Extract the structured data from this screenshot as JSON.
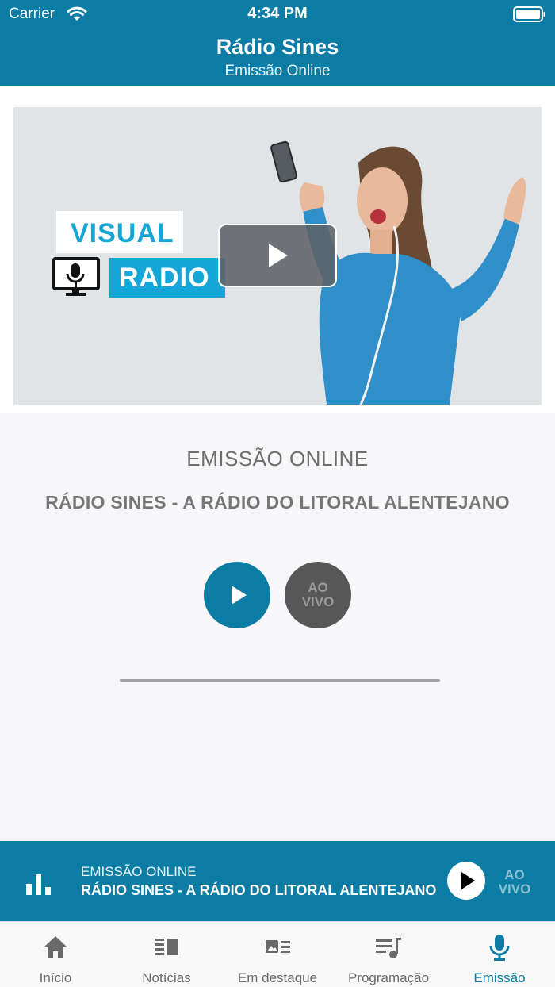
{
  "status_bar": {
    "carrier": "Carrier",
    "time": "4:34 PM"
  },
  "nav": {
    "title": "Rádio Sines",
    "subtitle": "Emissão Online"
  },
  "video": {
    "logo_line1": "VISUAL",
    "logo_line2": "RADIO"
  },
  "main": {
    "heading": "EMISSÃO ONLINE",
    "station": "RÁDIO SINES - A RÁDIO DO LITORAL ALENTEJANO",
    "live_line1": "AO",
    "live_line2": "VIVO"
  },
  "mini_player": {
    "line1": "EMISSÃO ONLINE",
    "line2": "RÁDIO SINES - A RÁDIO DO LITORAL ALENTEJANO",
    "live_line1": "AO",
    "live_line2": "VIVO"
  },
  "tabs": [
    {
      "label": "Início",
      "icon": "home-icon"
    },
    {
      "label": "Notícias",
      "icon": "news-icon"
    },
    {
      "label": "Em destaque",
      "icon": "featured-icon"
    },
    {
      "label": "Programação",
      "icon": "playlist-icon"
    },
    {
      "label": "Emissão",
      "icon": "microphone-icon",
      "active": true
    }
  ],
  "colors": {
    "accent": "#0b7da4",
    "logo_blue": "#14a6d7",
    "live_button": "#575757"
  }
}
